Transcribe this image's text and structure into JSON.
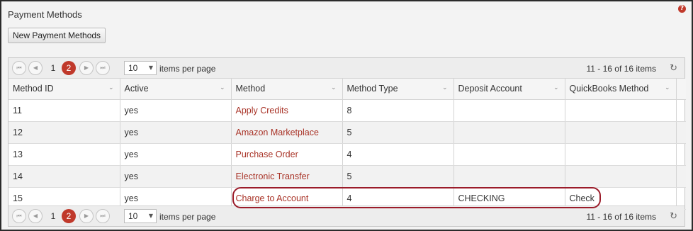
{
  "page": {
    "title": "Payment Methods",
    "help_icon": "question-icon"
  },
  "toolbar": {
    "new_label": "New Payment Methods"
  },
  "pager": {
    "pages": [
      "1",
      "2"
    ],
    "current_page": "2",
    "page_size": "10",
    "items_per_page_label": "items per page",
    "range_label": "11 - 16 of 16 items",
    "buttons": [
      "first-page-icon",
      "prev-page-icon",
      "next-page-icon",
      "last-page-icon",
      "refresh-icon"
    ]
  },
  "table": {
    "columns": [
      "Method ID",
      "Active",
      "Method",
      "Method Type",
      "Deposit Account",
      "QuickBooks Method"
    ],
    "rows": [
      {
        "id": "11",
        "active": "yes",
        "method": "Apply Credits",
        "type": "8",
        "deposit": "",
        "qb": ""
      },
      {
        "id": "12",
        "active": "yes",
        "method": "Amazon Marketplace",
        "type": "5",
        "deposit": "",
        "qb": ""
      },
      {
        "id": "13",
        "active": "yes",
        "method": "Purchase Order",
        "type": "4",
        "deposit": "",
        "qb": ""
      },
      {
        "id": "14",
        "active": "yes",
        "method": "Electronic Transfer",
        "type": "5",
        "deposit": "",
        "qb": ""
      },
      {
        "id": "15",
        "active": "yes",
        "method": "Charge to Account",
        "type": "4",
        "deposit": "CHECKING",
        "qb": "Check"
      }
    ]
  },
  "colors": {
    "accent": "#c0392b",
    "link": "#a83226",
    "highlight": "#9b1c2a"
  }
}
